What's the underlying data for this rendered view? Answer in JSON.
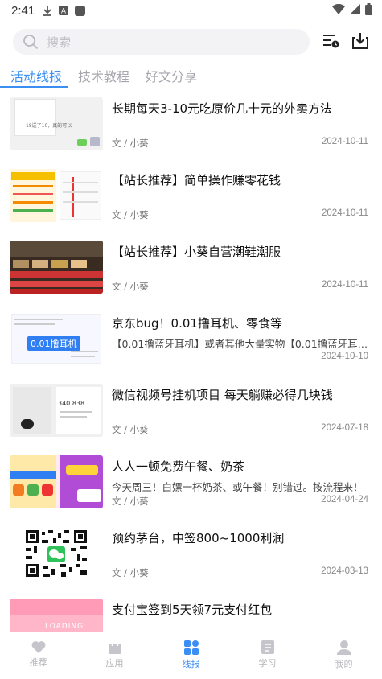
{
  "status_bar": {
    "time": "2:41"
  },
  "search": {
    "placeholder": "搜索"
  },
  "tabs": [
    {
      "label": "活动线报",
      "active": true
    },
    {
      "label": "技术教程",
      "active": false
    },
    {
      "label": "好文分享",
      "active": false
    }
  ],
  "articles": [
    {
      "title": "长期每天3-10元吃原价几十元的外卖方法",
      "desc": "",
      "author": "文 / 小葵",
      "date": "2024-10-11",
      "thumb_text": "18送了10，真的可以"
    },
    {
      "title": "【站长推荐】简单操作赚零花钱",
      "desc": "",
      "author": "文 / 小葵",
      "date": "2024-10-11",
      "thumb_text": ""
    },
    {
      "title": "【站长推荐】小葵自营潮鞋潮服",
      "desc": "",
      "author": "文 / 小葵",
      "date": "2024-10-11",
      "thumb_text": ""
    },
    {
      "title": "京东bug！0.01撸耳机、零食等",
      "desc": "【0.01撸蓝牙耳机】或者其他大量实物【0.01撸蓝牙耳机…",
      "author": "",
      "date": "2024-10-10",
      "thumb_text": "0.01撸耳机"
    },
    {
      "title": "微信视频号挂机项目 每天躺赚必得几块钱",
      "desc": "",
      "author": "文 / 小葵",
      "date": "2024-07-18",
      "thumb_text": "340.838"
    },
    {
      "title": "人人一顿免费午餐、奶茶",
      "desc": "今天周三！白嫖一杯奶茶、或午餐！别错过。按流程来！",
      "author": "文 / 小葵",
      "date": "2024-04-24",
      "thumb_text": ""
    },
    {
      "title": "预约茅台，中签800~1000利润",
      "desc": "",
      "author": "文 / 小葵",
      "date": "2024-03-13",
      "thumb_text": ""
    },
    {
      "title": "支付宝签到5天领7元支付红包",
      "desc": "",
      "author": "",
      "date": "",
      "thumb_text": "LOADING"
    }
  ],
  "bottom_nav": [
    {
      "label": "推荐",
      "icon": "heart-icon",
      "active": false
    },
    {
      "label": "应用",
      "icon": "bag-icon",
      "active": false
    },
    {
      "label": "线报",
      "icon": "grid-icon",
      "active": true
    },
    {
      "label": "学习",
      "icon": "book-icon",
      "active": false
    },
    {
      "label": "我的",
      "icon": "user-icon",
      "active": false
    }
  ],
  "colors": {
    "accent": "#3b8ff3",
    "inactive": "#b4b4ba"
  }
}
